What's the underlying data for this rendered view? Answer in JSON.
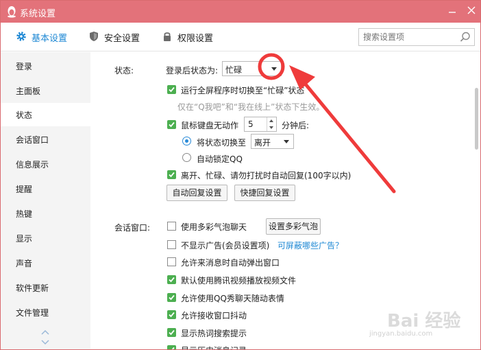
{
  "window": {
    "title": "系统设置",
    "title_color": "#e3727a"
  },
  "toolbar": {
    "tabs": [
      {
        "label": "基本设置",
        "icon": "gear-icon",
        "active": true
      },
      {
        "label": "安全设置",
        "icon": "shield-icon",
        "active": false
      },
      {
        "label": "权限设置",
        "icon": "lock-icon",
        "active": false
      }
    ],
    "search_placeholder": "搜索设置项",
    "accent_color": "#1e88d4"
  },
  "sidebar": {
    "items": [
      {
        "label": "登录"
      },
      {
        "label": "主面板"
      },
      {
        "label": "状态",
        "active": true
      },
      {
        "label": "会话窗口"
      },
      {
        "label": "信息展示"
      },
      {
        "label": "提醒"
      },
      {
        "label": "热键"
      },
      {
        "label": "显示"
      },
      {
        "label": "声音"
      },
      {
        "label": "软件更新"
      },
      {
        "label": "文件管理"
      }
    ]
  },
  "status_section": {
    "heading": "状态:",
    "login_status_label": "登录后状态为:",
    "login_status_value": "忙碌",
    "fullscreen_option": "运行全屏程序时切换至“忙碌”状态",
    "fullscreen_checked": true,
    "fullscreen_note": "仅在“Q我吧”和“我在线上”状态下生效。",
    "idle_option_prefix": "鼠标键盘无动作",
    "idle_minutes": "5",
    "idle_option_suffix": "分钟后:",
    "idle_checked": true,
    "radio_switch_label": "将状态切换至",
    "radio_switch_value": "离开",
    "radio_lock_label": "自动锁定QQ",
    "auto_reply_option": "离开、忙碌、请勿打扰时自动回复(100字以内)",
    "auto_reply_checked": true,
    "auto_reply_button": "自动回复设置",
    "quick_reply_button": "快捷回复设置"
  },
  "chat_section": {
    "heading": "会话窗口:",
    "colorful_bubble_option": "使用多彩气泡聊天",
    "colorful_bubble_button": "设置多彩气泡",
    "no_ads_option": "不显示广告(会员设置项)",
    "no_ads_link": "可屏蔽哪些广告？",
    "popup_option": "允许来消息时自动弹出窗口",
    "tencent_video_option": "默认使用腾讯视频播放视频文件",
    "qq_show_option": "允许使用QQ秀聊天随动表情",
    "shake_option": "允许接收窗口抖动",
    "hot_search_option": "显示热词搜索提示",
    "history_option": "显示历史消息记录"
  },
  "watermark": {
    "text": "Bai 经验",
    "sub": "jingyan.baidu.com"
  }
}
